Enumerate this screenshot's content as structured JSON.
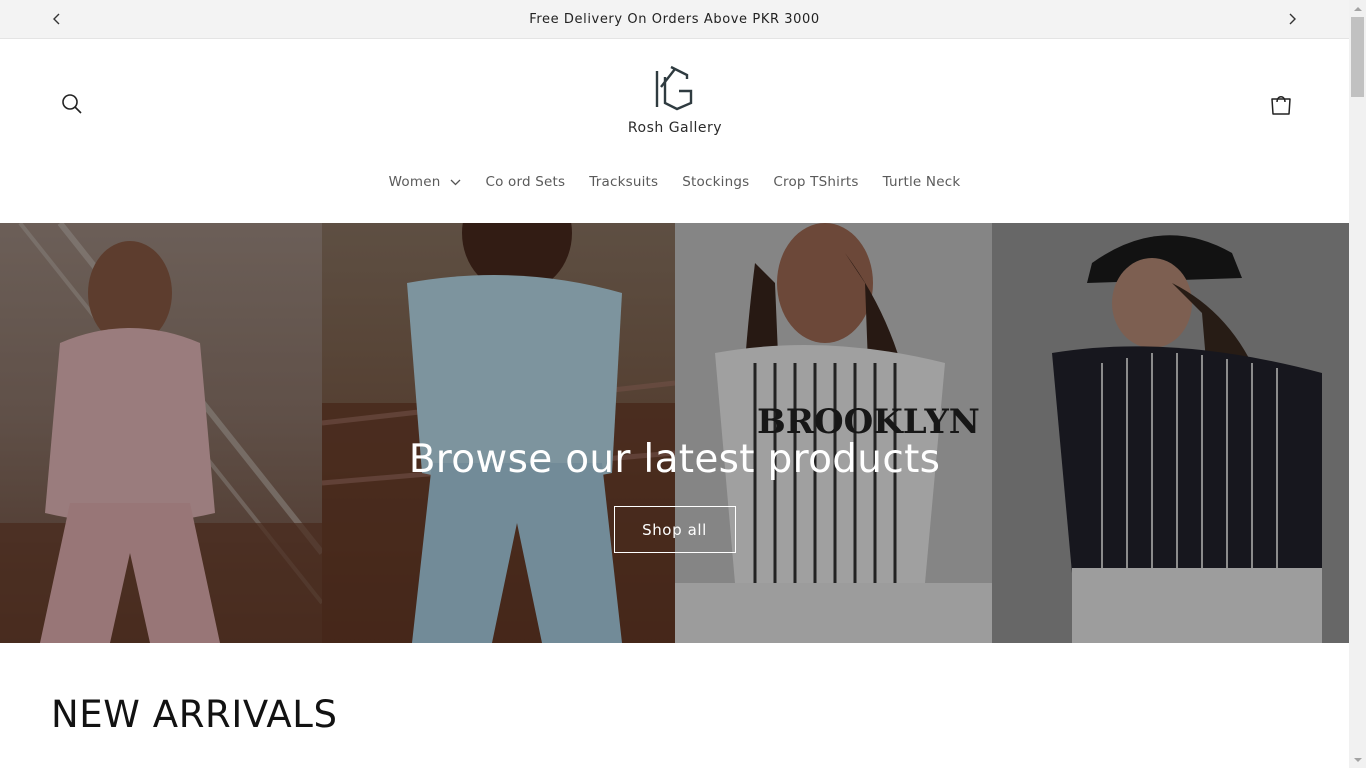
{
  "announcement": {
    "text": "Free Delivery On Orders Above PKR 3000"
  },
  "header": {
    "logo_text": "Rosh Gallery",
    "icons": {
      "search": "search-icon",
      "cart": "cart-icon"
    }
  },
  "nav": {
    "items": [
      {
        "label": "Women",
        "has_dropdown": true
      },
      {
        "label": "Co ord Sets"
      },
      {
        "label": "Tracksuits"
      },
      {
        "label": "Stockings"
      },
      {
        "label": "Crop TShirts"
      },
      {
        "label": "Turtle Neck"
      }
    ]
  },
  "hero": {
    "title": "Browse our latest products",
    "button_label": "Shop all",
    "print_text": "BROOKLYN"
  },
  "section": {
    "title": "NEW ARRIVALS"
  },
  "colors": {
    "announcement_bg": "#f3f3f3",
    "text": "#121212",
    "nav_text": "#5a5a5a"
  }
}
